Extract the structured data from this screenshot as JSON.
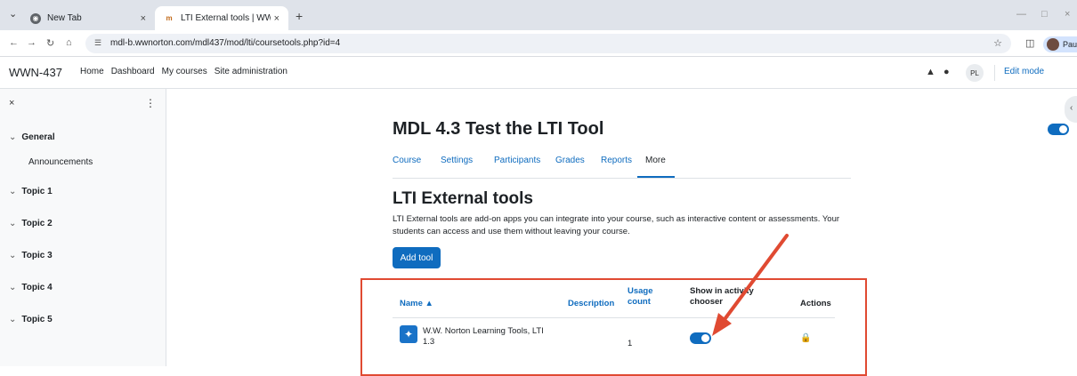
{
  "browser": {
    "tabs": [
      {
        "title": "New Tab",
        "active": false
      },
      {
        "title": "LTI External tools | WWN-437",
        "active": true
      }
    ],
    "url": "mdl-b.wwnorton.com/mdl437/mod/lti/coursetools.php?id=4",
    "profile_label": "Paused"
  },
  "navbar": {
    "brand": "WWN-437",
    "items": [
      "Home",
      "Dashboard",
      "My courses",
      "Site administration"
    ],
    "user_initials": "PL",
    "edit_mode_label": "Edit mode",
    "edit_mode_on": true
  },
  "drawer": {
    "sections": [
      {
        "label": "General",
        "items": [
          "Announcements"
        ]
      },
      {
        "label": "Topic 1",
        "items": []
      },
      {
        "label": "Topic 2",
        "items": []
      },
      {
        "label": "Topic 3",
        "items": []
      },
      {
        "label": "Topic 4",
        "items": []
      },
      {
        "label": "Topic 5",
        "items": []
      }
    ]
  },
  "main": {
    "course_title": "MDL 4.3 Test the LTI Tool",
    "secondary_nav": [
      "Course",
      "Settings",
      "Participants",
      "Grades",
      "Reports",
      "More"
    ],
    "secondary_nav_active": "More",
    "heading": "LTI External tools",
    "description": "LTI External tools are add-on apps you can integrate into your course, such as interactive content or assessments. Your students can access and use them without leaving your course.",
    "add_tool_label": "Add tool",
    "table": {
      "headers": {
        "name": "Name",
        "description": "Description",
        "usage": "Usage count",
        "show": "Show in activity chooser",
        "actions": "Actions"
      },
      "rows": [
        {
          "name": "W.W. Norton Learning Tools, LTI 1.3",
          "usage": "1",
          "show_in_chooser": true
        }
      ]
    }
  },
  "colors": {
    "brand_blue": "#0f6cbf",
    "annotation_red": "#e04a32"
  }
}
